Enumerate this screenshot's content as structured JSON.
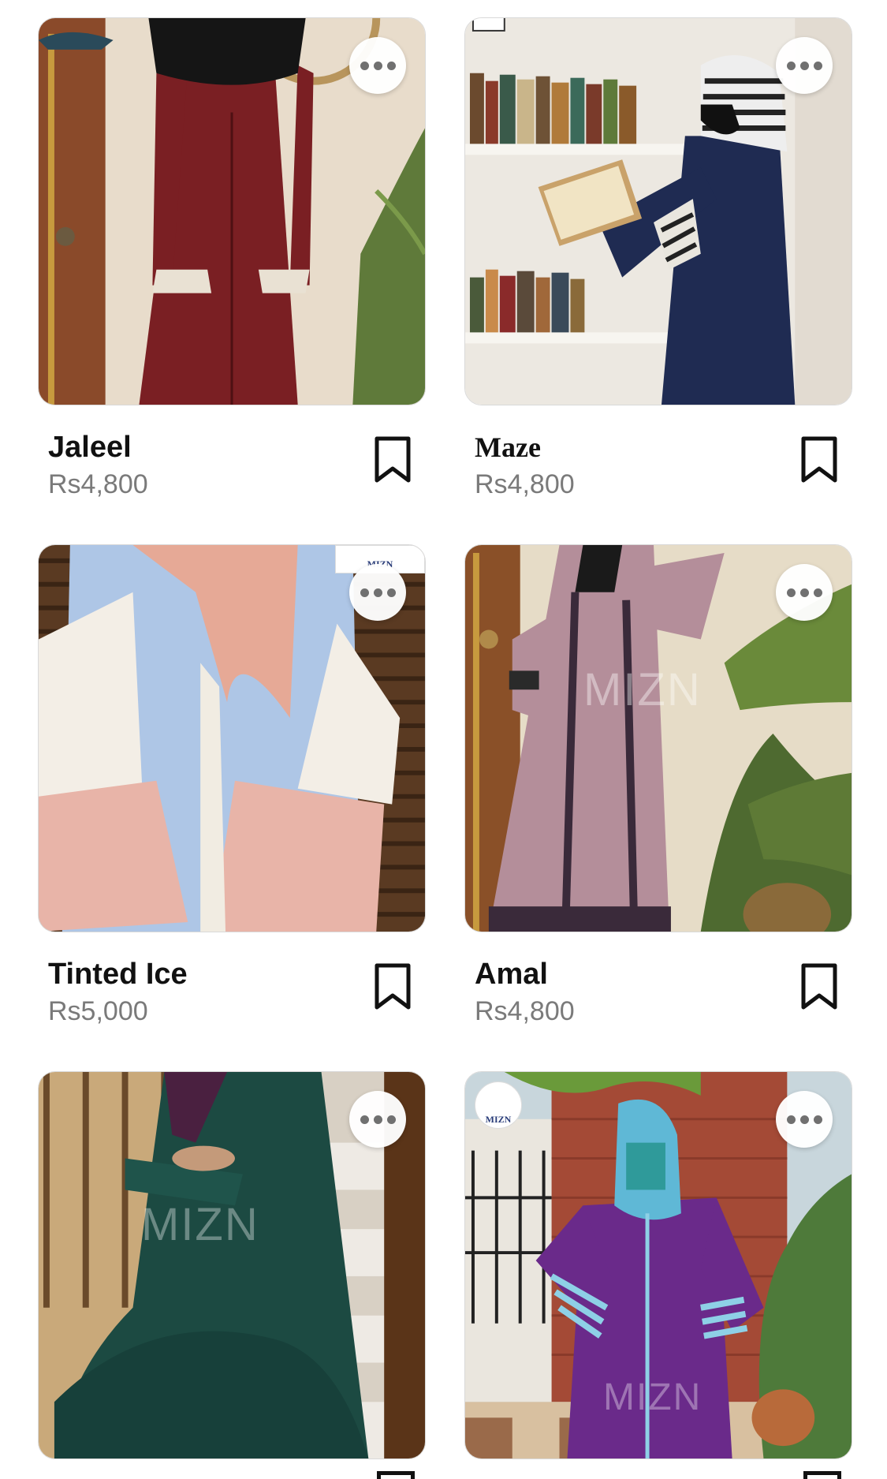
{
  "products": [
    {
      "name": "Jaleel",
      "price": "Rs4,800"
    },
    {
      "name": "Maze",
      "price": "Rs4,800"
    },
    {
      "name": "Tinted Ice",
      "price": "Rs5,000"
    },
    {
      "name": "Amal",
      "price": "Rs4,800"
    }
  ],
  "watermarks": {
    "brand": "MIZN"
  },
  "icons": {
    "more": "more-horizontal-icon",
    "save": "bookmark-icon"
  }
}
